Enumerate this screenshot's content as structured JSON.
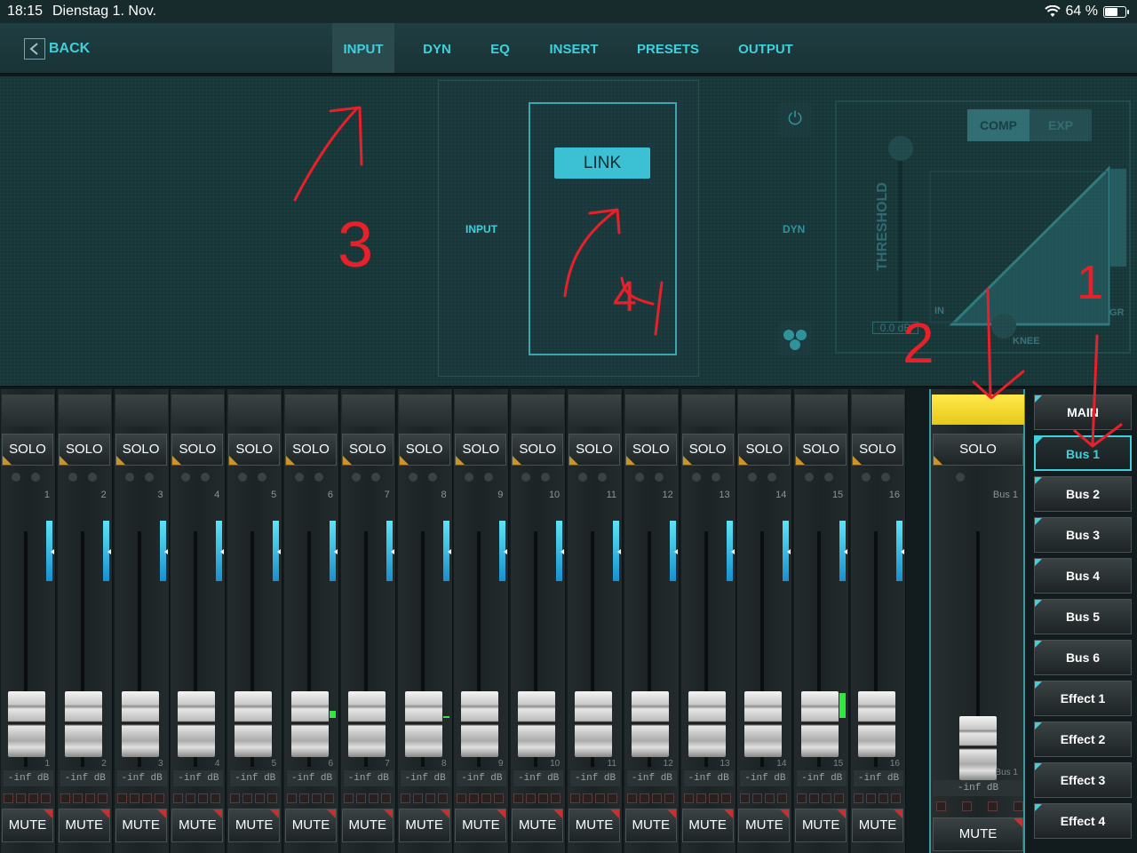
{
  "status": {
    "time": "18:15",
    "date": "Dienstag 1. Nov.",
    "battery": "64 %",
    "battery_level": 0.64
  },
  "nav": {
    "back_label": "BACK",
    "tabs": [
      {
        "label": "INPUT",
        "active": true
      },
      {
        "label": "DYN",
        "active": false
      },
      {
        "label": "EQ",
        "active": false
      },
      {
        "label": "INSERT",
        "active": false
      },
      {
        "label": "PRESETS",
        "active": false
      },
      {
        "label": "OUTPUT",
        "active": false
      }
    ]
  },
  "panel": {
    "input_label": "INPUT",
    "link_label": "LINK",
    "dyn_label": "DYN",
    "comp_label": "COMP",
    "exp_label": "EXP",
    "threshold_label": "THRESHOLD",
    "threshold_value": "0.0 dB",
    "in_label": "IN",
    "gr_label": "GR",
    "knee_label": "KNEE"
  },
  "channels": {
    "solo_label": "SOLO",
    "mute_label": "MUTE",
    "level_label": "-inf dB",
    "numbers": [
      "1",
      "2",
      "3",
      "4",
      "5",
      "6",
      "7",
      "8",
      "9",
      "10",
      "11",
      "12",
      "13",
      "14",
      "15",
      "16"
    ]
  },
  "bus_strip": {
    "name": "Bus 1",
    "solo_label": "SOLO",
    "mute_label": "MUTE",
    "level_label": "-inf dB"
  },
  "routing": {
    "items": [
      "MAIN",
      "Bus 1",
      "Bus 2",
      "Bus 3",
      "Bus 4",
      "Bus 5",
      "Bus 6",
      "Effect 1",
      "Effect 2",
      "Effect 3",
      "Effect 4"
    ],
    "active": "Bus 1"
  },
  "annotations": [
    "3",
    "4",
    "2",
    "1"
  ],
  "colors": {
    "accent": "#3fd0dc",
    "link_button": "#3cc0d4",
    "solo_marker": "#c9942a",
    "mute_marker": "#c83030",
    "bus_header": "#ffe94a",
    "annotation": "#e8202a"
  }
}
